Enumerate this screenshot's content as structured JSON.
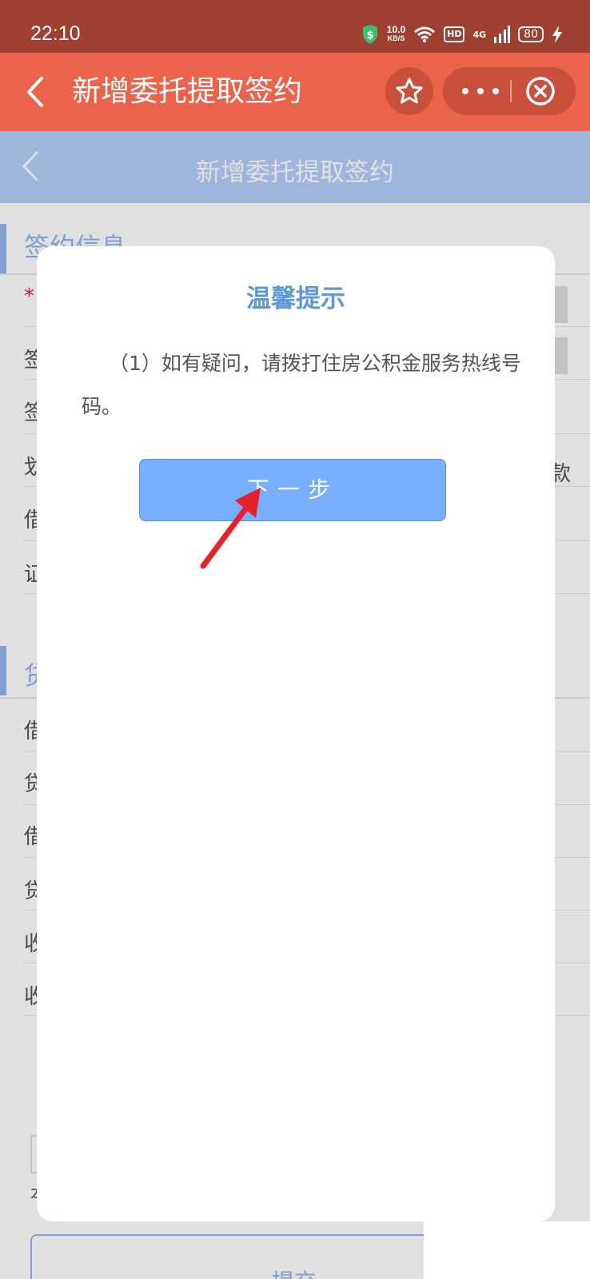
{
  "status_bar": {
    "time": "22:10",
    "net_speed_value": "10.0",
    "net_speed_unit": "KB/S",
    "hd_label": "HD",
    "network_label": "4G",
    "battery": "80",
    "icons": [
      "shield-dollar-icon",
      "wifi-icon",
      "signal-icon",
      "charging-bolt-icon"
    ]
  },
  "mp_nav": {
    "title": "新增委托提取签约",
    "icons": [
      "back-chevron-icon",
      "star-icon",
      "more-dots-icon",
      "close-circle-icon"
    ]
  },
  "page_header": {
    "title": "新增委托提取签约"
  },
  "background_form": {
    "section1_title": "签约信息",
    "section2_title": "贷",
    "required_mark": "*",
    "row_labels": [
      "签",
      "签",
      "划",
      "借",
      "证"
    ],
    "row_tail": "款",
    "section2_row_labels": [
      "借",
      "贷",
      "借",
      "贷",
      "收",
      "收"
    ],
    "checkbox_label": "本",
    "submit_label": "提交"
  },
  "modal": {
    "title": "温馨提示",
    "message": "（1）如有疑问，请拨打住房公积金服务热线号码。",
    "next_button": "下一步"
  },
  "colors": {
    "status_bar": "#a04030",
    "mp_nav": "#ec634c",
    "page_header": "#b4d0fa",
    "modal_title": "#5e98d8",
    "next_button": "#78aeff",
    "annotation_arrow": "#e8202a"
  }
}
